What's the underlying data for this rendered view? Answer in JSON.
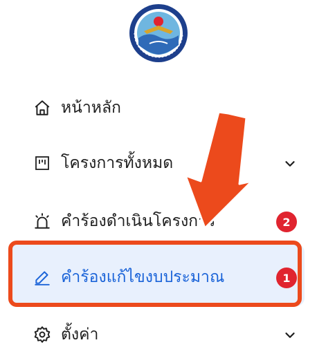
{
  "logo": {
    "name": "organization-seal",
    "text": "องค์การบริหารส่วนจังหวัดชลบุรี"
  },
  "menu": {
    "items": [
      {
        "label": "หน้าหลัก",
        "icon": "home-icon",
        "has_chevron": false,
        "badge": ""
      },
      {
        "label": "โครงการทั้งหมด",
        "icon": "kanban-icon",
        "has_chevron": true,
        "badge": ""
      },
      {
        "label": "คำร้องดำเนินโครงการ",
        "icon": "alarm-light-icon",
        "has_chevron": false,
        "badge": "2"
      },
      {
        "label": "คำร้องแก้ไขงบประมาณ",
        "icon": "pencil-icon",
        "has_chevron": false,
        "badge": "1",
        "active": true
      },
      {
        "label": "ตั้งค่า",
        "icon": "gear-icon",
        "has_chevron": true,
        "badge": ""
      }
    ]
  },
  "annotation": {
    "arrow_color": "#ec4a1c",
    "box_color": "#ec4a1c"
  },
  "colors": {
    "active_text": "#1a63d8",
    "active_background": "#e8f0fd",
    "badge": "#e0242f"
  }
}
